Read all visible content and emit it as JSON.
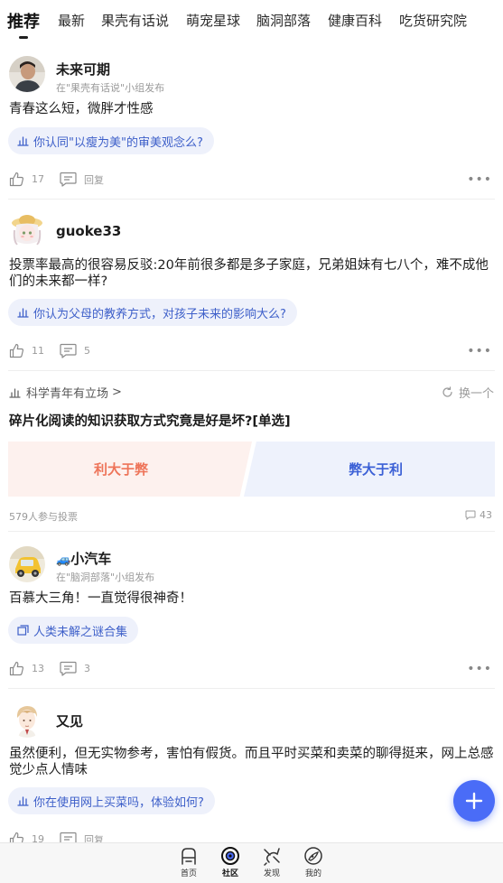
{
  "tabs": [
    {
      "label": "推荐",
      "active": true
    },
    {
      "label": "最新"
    },
    {
      "label": "果壳有话说"
    },
    {
      "label": "萌宠星球"
    },
    {
      "label": "脑洞部落"
    },
    {
      "label": "健康百科"
    },
    {
      "label": "吃货研究院"
    }
  ],
  "posts": [
    {
      "author": "未来可期",
      "group_note": "在\"果壳有话说\"小组发布",
      "text": "青春这么短，微胖才性感",
      "topic": "你认同\"以瘦为美\"的审美观念么?",
      "likes": "17",
      "comments": "回复"
    },
    {
      "author": "guoke33",
      "text": "投票率最高的很容易反驳:20年前很多都是多子家庭，兄弟姐妹有七八个，难不成他们的未来都一样?",
      "topic": "你认为父母的教养方式，对孩子未来的影响大么?",
      "likes": "11",
      "comments": "5"
    },
    {
      "author": "小汽车",
      "author_emoji": "🚙",
      "group_note": "在\"脑洞部落\"小组发布",
      "text": "百慕大三角！一直觉得很神奇！",
      "topic": "人类未解之谜合集",
      "likes": "13",
      "comments": "3"
    },
    {
      "author": "又见",
      "text": "虽然便利，但无实物参考，害怕有假货。而且平时买菜和卖菜的聊得挺来，网上总感觉少点人情味",
      "topic": "你在使用网上买菜吗，体验如何?",
      "likes": "19",
      "comments": "回复"
    }
  ],
  "vote": {
    "source": "科学青年有立场",
    "source_chevron": ">",
    "refresh_label": "换一个",
    "question": "碎片化阅读的知识获取方式究竟是好是坏?[单选]",
    "option_a": "利大于弊",
    "option_b": "弊大于利",
    "participants": "579人参与投票",
    "comments": "43"
  },
  "bottom_nav": [
    {
      "label": "首页",
      "icon": "home-icon"
    },
    {
      "label": "社区",
      "icon": "community-icon",
      "active": true
    },
    {
      "label": "发现",
      "icon": "discover-icon"
    },
    {
      "label": "我的",
      "icon": "profile-icon"
    }
  ],
  "colors": {
    "accent": "#4a6cf7",
    "topic_chip_bg": "#eef1fb",
    "topic_chip_text": "#3d5fc9",
    "vote_a": "#ee7459",
    "vote_b": "#3c61d6"
  }
}
